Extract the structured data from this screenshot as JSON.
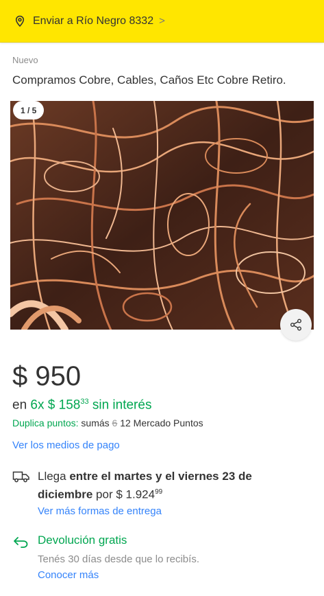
{
  "shipping_bar": {
    "label": "Enviar a Río Negro 8332",
    "chevron": ">"
  },
  "product": {
    "condition": "Nuevo",
    "title": "Compramos Cobre, Cables, Caños Etc Cobre Retiro."
  },
  "gallery": {
    "counter": "1 / 5",
    "image_alt": "copper wire scrap photo"
  },
  "price": {
    "amount": "$ 950",
    "installments_prefix": "en",
    "installments_count": "6x",
    "installment_price": "$ 158",
    "installment_cents": "33",
    "installments_suffix": "sin interés"
  },
  "points": {
    "label": "Duplica puntos:",
    "text_before": "sumás",
    "old_value": "6",
    "new_value": "12 Mercado Puntos"
  },
  "payment_link": "Ver los medios de pago",
  "delivery": {
    "prefix": "Llega",
    "range": "entre el martes y el viernes 23 de diciembre",
    "by": "por",
    "cost": "$ 1.924",
    "cost_cents": "99",
    "more_link": "Ver más formas de entrega"
  },
  "returns": {
    "title": "Devolución gratis",
    "subtitle": "Tenés 30 días desde que lo recibís.",
    "link": "Conocer más"
  },
  "colors": {
    "brand_yellow": "#ffe600",
    "green": "#00a650",
    "link_blue": "#3483fa"
  },
  "icons": [
    "location-pin-icon",
    "chevron-right-icon",
    "share-icon",
    "truck-icon",
    "return-arrow-icon"
  ]
}
